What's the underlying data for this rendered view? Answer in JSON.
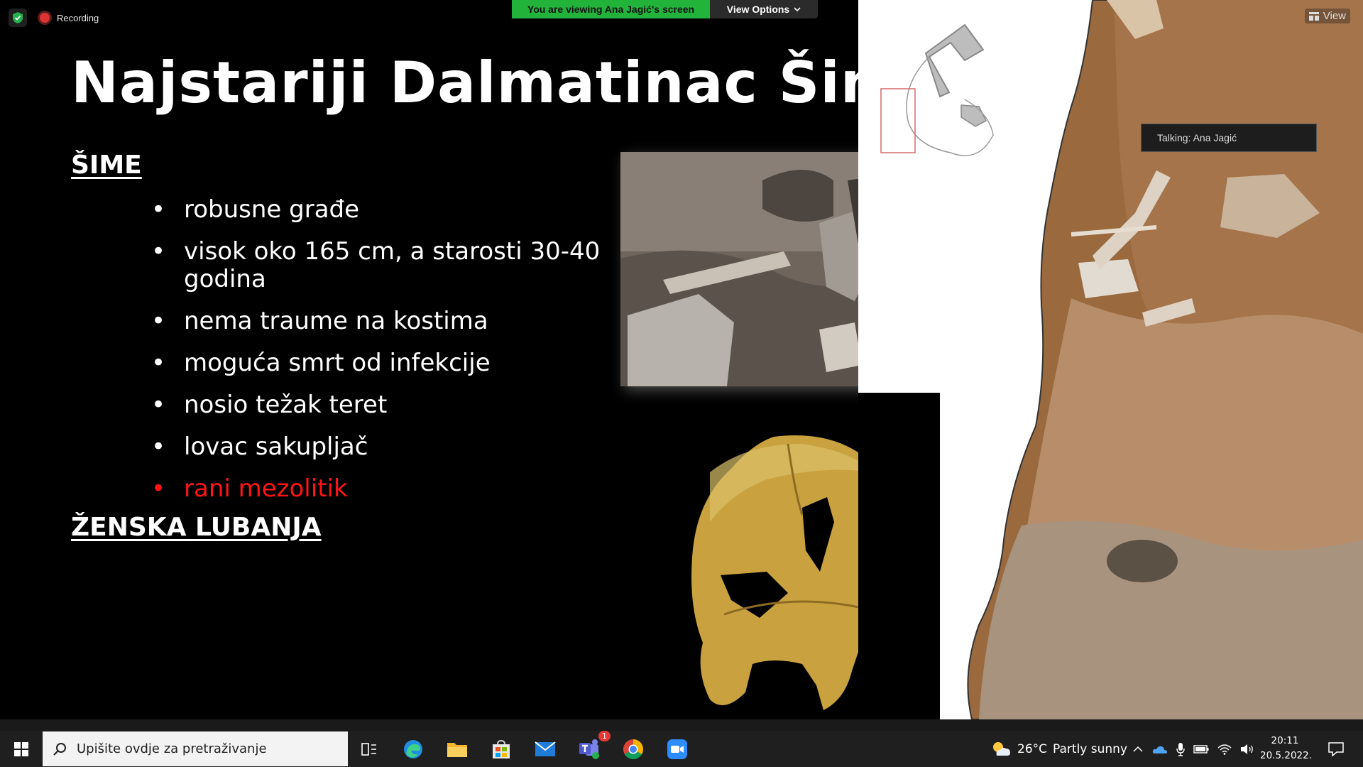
{
  "zoom": {
    "recording_label": "Recording",
    "viewing_banner": "You are viewing Ana Jagić's screen",
    "view_options_label": "View Options",
    "view_label": "View",
    "talking_label": "Talking: Ana Jagić"
  },
  "slide": {
    "title": "Najstariji Dalmatinac Šime",
    "section_1": "ŠIME",
    "bullets": [
      "robusne građe",
      "visok oko 165 cm, a starosti 30-40 godina",
      "nema traume na kostima",
      "moguća smrt od infekcije",
      "nosio težak teret",
      "lovac sakupljač",
      "rani mezolitik"
    ],
    "section_2": "ŽENSKA LUBANJA",
    "colors": {
      "background": "#000000",
      "text": "#ffffff",
      "highlight": "#ff1414"
    }
  },
  "taskbar": {
    "search_placeholder": "Upišite ovdje za pretraživanje",
    "weather_temp": "26°C",
    "weather_desc": "Partly sunny",
    "time": "20:11",
    "date": "20.5.2022.",
    "teams_badge": "1",
    "apps": [
      "task-view",
      "edge",
      "file-explorer",
      "microsoft-store",
      "mail",
      "teams",
      "chrome",
      "zoom"
    ]
  }
}
